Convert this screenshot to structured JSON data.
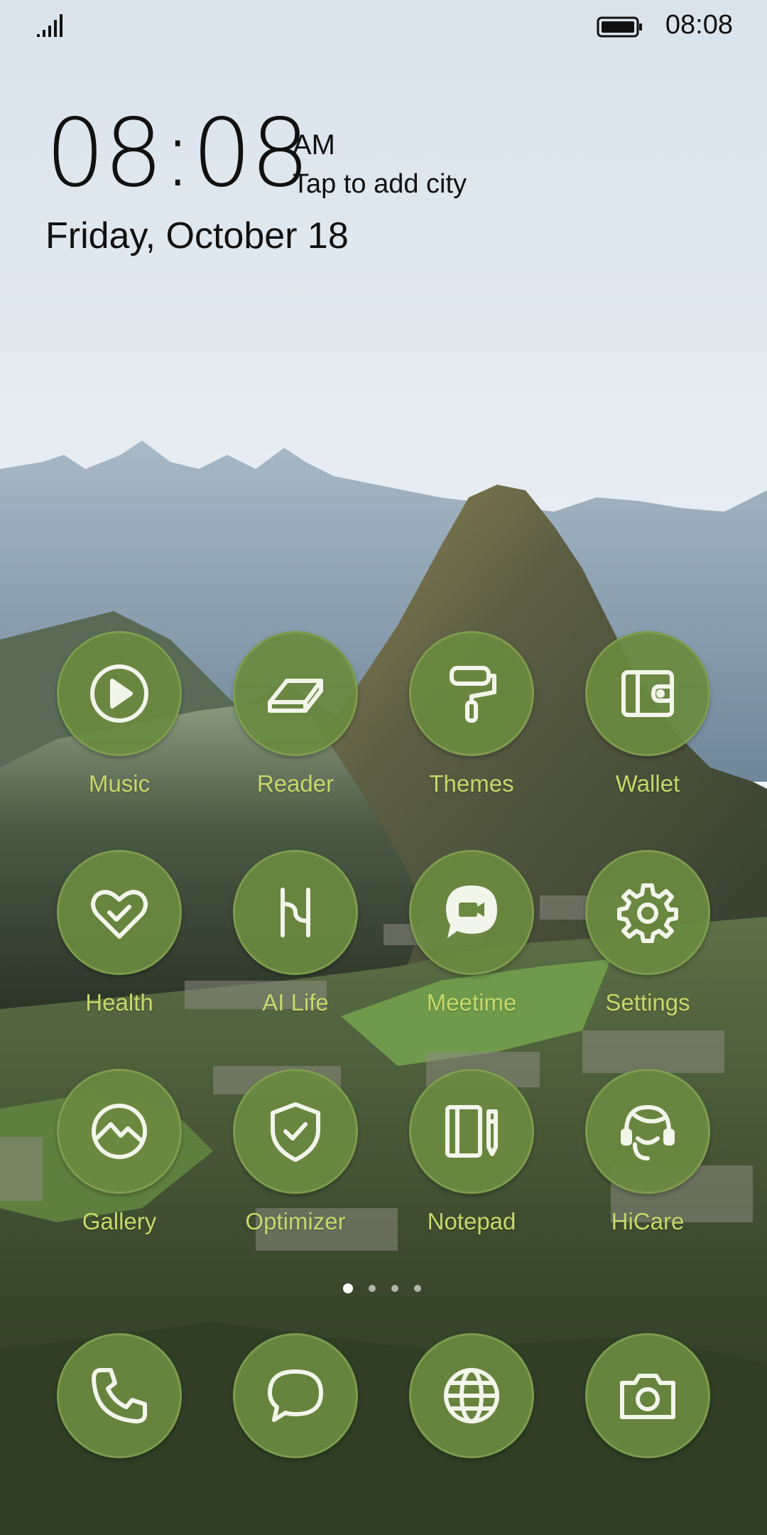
{
  "status_bar": {
    "time": "08:08",
    "signal_icon": "signal-icon",
    "battery_icon": "battery-icon"
  },
  "clock_widget": {
    "time": "08:08",
    "ampm": "AM",
    "weather_prompt": "Tap to add city",
    "date": "Friday, October 18"
  },
  "apps": [
    {
      "label": "Music",
      "icon": "play-icon"
    },
    {
      "label": "Reader",
      "icon": "book-icon"
    },
    {
      "label": "Themes",
      "icon": "paint-roller-icon"
    },
    {
      "label": "Wallet",
      "icon": "wallet-icon"
    },
    {
      "label": "Health",
      "icon": "heart-check-icon"
    },
    {
      "label": "AI Life",
      "icon": "ai-life-icon"
    },
    {
      "label": "Meetime",
      "icon": "video-chat-icon"
    },
    {
      "label": "Settings",
      "icon": "gear-icon"
    },
    {
      "label": "Gallery",
      "icon": "gallery-icon"
    },
    {
      "label": "Optimizer",
      "icon": "shield-check-icon"
    },
    {
      "label": "Notepad",
      "icon": "notepad-icon"
    },
    {
      "label": "HiCare",
      "icon": "headset-icon"
    }
  ],
  "page_indicator": {
    "pages": 4,
    "current": 1
  },
  "dock": [
    {
      "icon": "phone-icon"
    },
    {
      "icon": "message-icon"
    },
    {
      "icon": "browser-icon"
    },
    {
      "icon": "camera-icon"
    }
  ],
  "colors": {
    "icon_circle": "#6a8a3f",
    "icon_label": "#c7d86a",
    "icon_glyph": "#f2f5ea"
  }
}
